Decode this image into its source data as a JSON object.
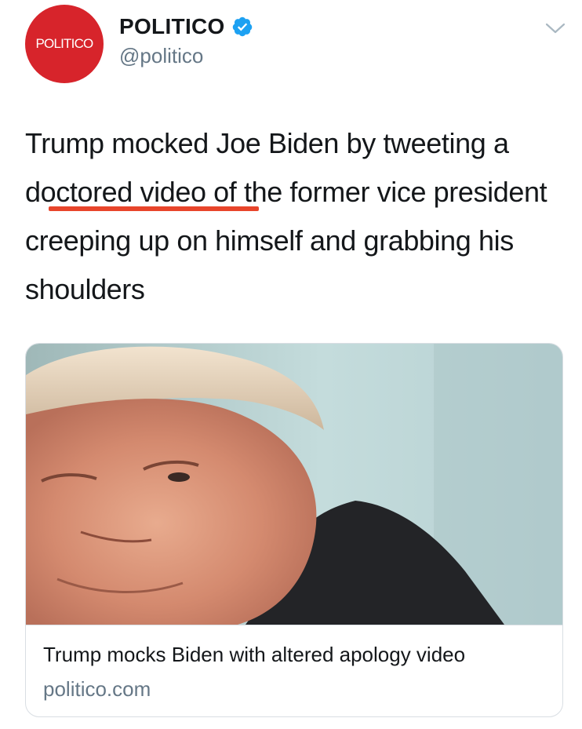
{
  "author": {
    "avatar_text": "POLITICO",
    "name": "POLITICO",
    "handle": "@politico",
    "verified_icon": "verified-badge-icon",
    "brand_color": "#d7242b"
  },
  "tweet": {
    "text_before": "Trump mocked Joe Biden by tweeting a ",
    "text_highlight": "doctored video",
    "text_after": " of the former vice president creeping up on himself and grabbing his shoulders",
    "highlight_color": "#e8452b"
  },
  "card": {
    "image_icon": "trump-photo",
    "title": "Trump mocks Biden with altered apology video",
    "domain": "politico.com"
  },
  "menu_icon": "chevron-down-icon"
}
